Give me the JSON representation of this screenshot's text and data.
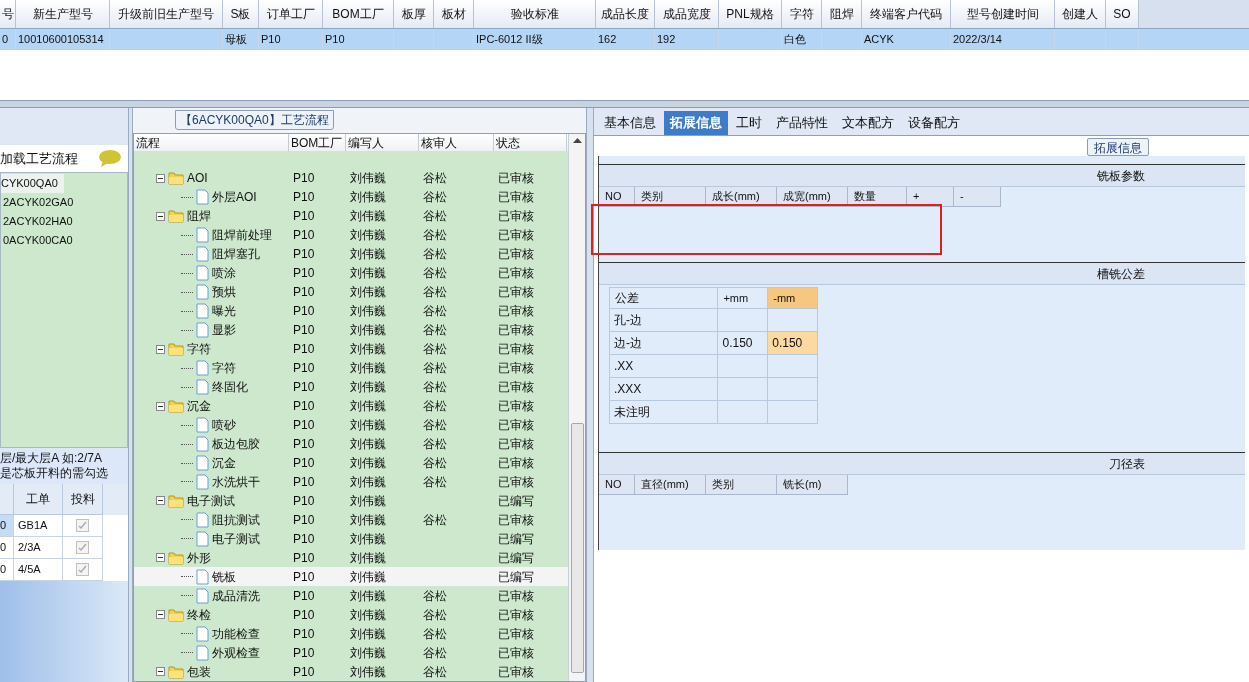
{
  "top_grid": {
    "columns": [
      "号",
      "新生产型号",
      "升级前旧生产型号",
      "S板",
      "订单工厂",
      "BOM工厂",
      "板厚",
      "板材",
      "验收标准",
      "成品长度",
      "成品宽度",
      "PNL规格",
      "字符",
      "阻焊",
      "终端客户代码",
      "型号创建时间",
      "创建人",
      "SO"
    ],
    "rows": [
      {
        "selected": true,
        "cells": [
          "0",
          "10010600105314",
          null,
          "母板",
          "P10",
          "P10",
          null,
          null,
          "IPC-6012 II级",
          "162",
          "192",
          null,
          "白色",
          null,
          "ACYK",
          "2022/3/14",
          null,
          null
        ]
      }
    ]
  },
  "left_panel": {
    "load_label": "加载工艺流程",
    "versions": [
      {
        "label": "CYK00QA0",
        "selected": true
      },
      {
        "label": "2ACYK02GA0",
        "selected": false
      },
      {
        "label": "2ACYK02HA0",
        "selected": false
      },
      {
        "label": "0ACYK00CA0",
        "selected": false
      }
    ],
    "hint_lines": [
      "层/最大层A 如:2/7A",
      "是芯板开料的需勾选"
    ],
    "table": {
      "columns": [
        "工单",
        "投料"
      ],
      "rows": [
        {
          "column_1": "0",
          "work_order": "GB1A",
          "fed": true
        },
        {
          "column_1": "0",
          "work_order": "2/3A",
          "fed": true
        },
        {
          "column_1": "0",
          "work_order": "4/5A",
          "fed": true
        }
      ]
    }
  },
  "process_panel": {
    "title": "【6ACYK00QA0】工艺流程",
    "columns": [
      "流程",
      "BOM工厂",
      "编写人",
      "核审人",
      "状态"
    ],
    "steps": [
      {
        "name": "AOI",
        "bom": "P10",
        "writer": "刘伟巍",
        "reviewer": "谷松",
        "status": "已审核",
        "expanded": true,
        "selected": false,
        "children": [
          {
            "name": "外层AOI",
            "bom": "P10",
            "writer": "刘伟巍",
            "reviewer": "谷松",
            "status": "已审核",
            "selected": false
          }
        ]
      },
      {
        "name": "阻焊",
        "bom": "P10",
        "writer": "刘伟巍",
        "reviewer": "谷松",
        "status": "已审核",
        "expanded": true,
        "selected": false,
        "children": [
          {
            "name": "阻焊前处理",
            "bom": "P10",
            "writer": "刘伟巍",
            "reviewer": "谷松",
            "status": "已审核",
            "selected": false
          },
          {
            "name": "阻焊塞孔",
            "bom": "P10",
            "writer": "刘伟巍",
            "reviewer": "谷松",
            "status": "已审核",
            "selected": false
          },
          {
            "name": "喷涂",
            "bom": "P10",
            "writer": "刘伟巍",
            "reviewer": "谷松",
            "status": "已审核",
            "selected": false
          },
          {
            "name": "预烘",
            "bom": "P10",
            "writer": "刘伟巍",
            "reviewer": "谷松",
            "status": "已审核",
            "selected": false
          },
          {
            "name": "曝光",
            "bom": "P10",
            "writer": "刘伟巍",
            "reviewer": "谷松",
            "status": "已审核",
            "selected": false
          },
          {
            "name": "显影",
            "bom": "P10",
            "writer": "刘伟巍",
            "reviewer": "谷松",
            "status": "已审核",
            "selected": false
          }
        ]
      },
      {
        "name": "字符",
        "bom": "P10",
        "writer": "刘伟巍",
        "reviewer": "谷松",
        "status": "已审核",
        "expanded": true,
        "selected": false,
        "children": [
          {
            "name": "字符",
            "bom": "P10",
            "writer": "刘伟巍",
            "reviewer": "谷松",
            "status": "已审核",
            "selected": false
          },
          {
            "name": "终固化",
            "bom": "P10",
            "writer": "刘伟巍",
            "reviewer": "谷松",
            "status": "已审核",
            "selected": false
          }
        ]
      },
      {
        "name": "沉金",
        "bom": "P10",
        "writer": "刘伟巍",
        "reviewer": "谷松",
        "status": "已审核",
        "expanded": true,
        "selected": false,
        "children": [
          {
            "name": "喷砂",
            "bom": "P10",
            "writer": "刘伟巍",
            "reviewer": "谷松",
            "status": "已审核",
            "selected": false
          },
          {
            "name": "板边包胶",
            "bom": "P10",
            "writer": "刘伟巍",
            "reviewer": "谷松",
            "status": "已审核",
            "selected": false
          },
          {
            "name": "沉金",
            "bom": "P10",
            "writer": "刘伟巍",
            "reviewer": "谷松",
            "status": "已审核",
            "selected": false
          },
          {
            "name": "水洗烘干",
            "bom": "P10",
            "writer": "刘伟巍",
            "reviewer": "谷松",
            "status": "已审核",
            "selected": false
          }
        ]
      },
      {
        "name": "电子测试",
        "bom": "P10",
        "writer": "刘伟巍",
        "status": "已编写",
        "expanded": true,
        "selected": false,
        "children": [
          {
            "name": "阻抗测试",
            "bom": "P10",
            "writer": "刘伟巍",
            "reviewer": "谷松",
            "status": "已审核",
            "selected": false
          },
          {
            "name": "电子测试",
            "bom": "P10",
            "writer": "刘伟巍",
            "status": "已编写",
            "selected": false
          }
        ]
      },
      {
        "name": "外形",
        "bom": "P10",
        "writer": "刘伟巍",
        "status": "已编写",
        "expanded": true,
        "selected": false,
        "children": [
          {
            "name": "铣板",
            "bom": "P10",
            "writer": "刘伟巍",
            "status": "已编写",
            "selected": true
          },
          {
            "name": "成品清洗",
            "bom": "P10",
            "writer": "刘伟巍",
            "reviewer": "谷松",
            "status": "已审核",
            "selected": false
          }
        ]
      },
      {
        "name": "终检",
        "bom": "P10",
        "writer": "刘伟巍",
        "reviewer": "谷松",
        "status": "已审核",
        "expanded": true,
        "selected": false,
        "children": [
          {
            "name": "功能检查",
            "bom": "P10",
            "writer": "刘伟巍",
            "reviewer": "谷松",
            "status": "已审核",
            "selected": false
          },
          {
            "name": "外观检查",
            "bom": "P10",
            "writer": "刘伟巍",
            "reviewer": "谷松",
            "status": "已审核",
            "selected": false
          }
        ]
      },
      {
        "name": "包装",
        "bom": "P10",
        "writer": "刘伟巍",
        "reviewer": "谷松",
        "status": "已审核",
        "expanded": true,
        "selected": false
      }
    ]
  },
  "detail_panel": {
    "tabs": [
      {
        "label": "基本信息",
        "selected": false
      },
      {
        "label": "拓展信息",
        "selected": true
      },
      {
        "label": "工时",
        "selected": false
      },
      {
        "label": "产品特性",
        "selected": false
      },
      {
        "label": "文本配方",
        "selected": false
      },
      {
        "label": "设备配方",
        "selected": false
      }
    ],
    "group_title": "拓展信息",
    "sections": [
      {
        "kind": "columns",
        "title": "铣板参数",
        "columns": [
          "NO",
          "类别",
          "成长(mm)",
          "成宽(mm)",
          "数量",
          "+",
          "-"
        ]
      },
      {
        "kind": "tolerance",
        "title": "槽铣公差",
        "columns": [
          {
            "label": "公差",
            "selected": false
          },
          {
            "label": "+mm",
            "selected": false
          },
          {
            "label": "-mm",
            "selected": true
          }
        ],
        "rows": [
          {
            "label": "孔-边",
            "selected": false
          },
          {
            "label": "边-边",
            "plus": "0.150",
            "minus": "0.150",
            "selected": true
          },
          {
            "label": ".XX",
            "selected": false
          },
          {
            "label": ".XXX",
            "selected": false
          },
          {
            "label": "未注明",
            "selected": false
          }
        ]
      },
      {
        "kind": "columns",
        "title": "刀径表",
        "columns": [
          "NO",
          "直径(mm)",
          "类别",
          "铣长(m)"
        ]
      }
    ]
  }
}
